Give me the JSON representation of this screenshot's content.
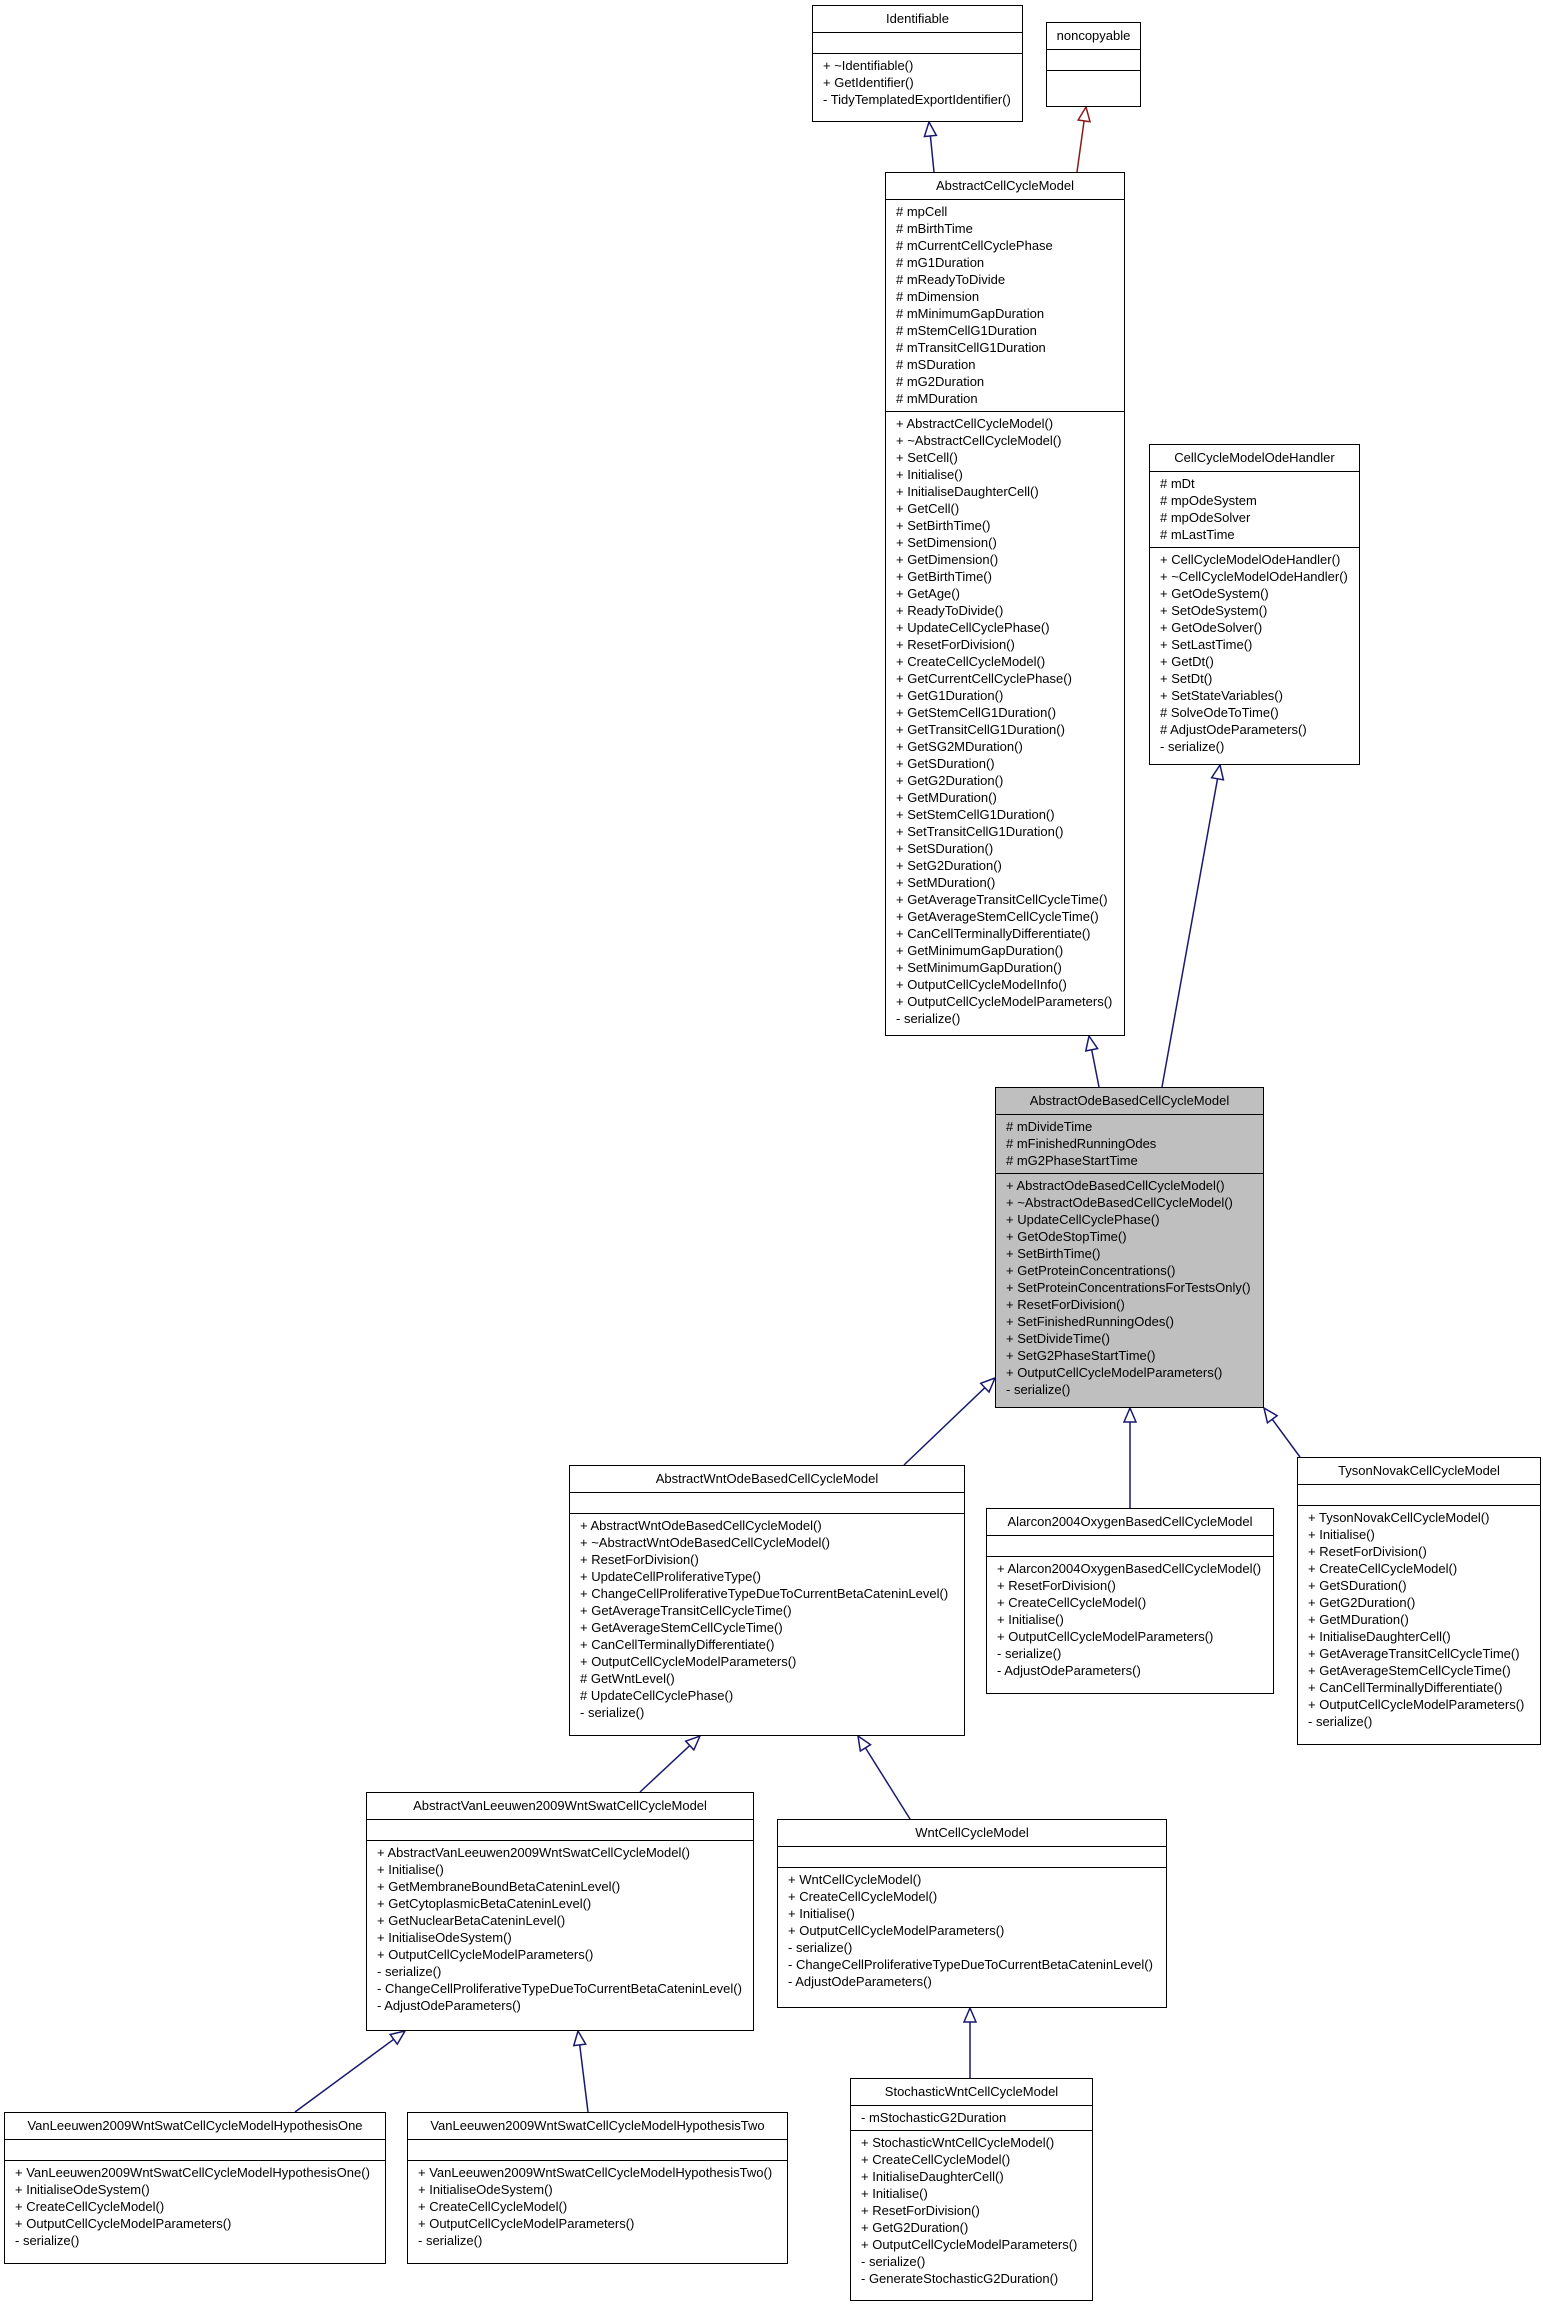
{
  "diagram": {
    "colors": {
      "inherit_public": "#191970",
      "inherit_private": "#8b1a1a",
      "focus_fill": "#bfbfbf"
    },
    "classes": [
      {
        "id": "identifiable",
        "name": "Identifiable",
        "attributes": [],
        "methods": [
          "+ ~Identifiable()",
          "+ GetIdentifier()",
          "- TidyTemplatedExportIdentifier()"
        ]
      },
      {
        "id": "noncopyable",
        "name": "noncopyable",
        "attributes": [],
        "methods": []
      },
      {
        "id": "abstract-cell-cycle-model",
        "name": "AbstractCellCycleModel",
        "attributes": [
          "# mpCell",
          "# mBirthTime",
          "# mCurrentCellCyclePhase",
          "# mG1Duration",
          "# mReadyToDivide",
          "# mDimension",
          "# mMinimumGapDuration",
          "# mStemCellG1Duration",
          "# mTransitCellG1Duration",
          "# mSDuration",
          "# mG2Duration",
          "# mMDuration"
        ],
        "methods": [
          "+ AbstractCellCycleModel()",
          "+ ~AbstractCellCycleModel()",
          "+ SetCell()",
          "+ Initialise()",
          "+ InitialiseDaughterCell()",
          "+ GetCell()",
          "+ SetBirthTime()",
          "+ SetDimension()",
          "+ GetDimension()",
          "+ GetBirthTime()",
          "+ GetAge()",
          "+ ReadyToDivide()",
          "+ UpdateCellCyclePhase()",
          "+ ResetForDivision()",
          "+ CreateCellCycleModel()",
          "+ GetCurrentCellCyclePhase()",
          "+ GetG1Duration()",
          "+ GetStemCellG1Duration()",
          "+ GetTransitCellG1Duration()",
          "+ GetSG2MDuration()",
          "+ GetSDuration()",
          "+ GetG2Duration()",
          "+ GetMDuration()",
          "+ SetStemCellG1Duration()",
          "+ SetTransitCellG1Duration()",
          "+ SetSDuration()",
          "+ SetG2Duration()",
          "+ SetMDuration()",
          "+ GetAverageTransitCellCycleTime()",
          "+ GetAverageStemCellCycleTime()",
          "+ CanCellTerminallyDifferentiate()",
          "+ GetMinimumGapDuration()",
          "+ SetMinimumGapDuration()",
          "+ OutputCellCycleModelInfo()",
          "+ OutputCellCycleModelParameters()",
          "- serialize()"
        ]
      },
      {
        "id": "cell-cycle-model-ode-handler",
        "name": "CellCycleModelOdeHandler",
        "attributes": [
          "# mDt",
          "# mpOdeSystem",
          "# mpOdeSolver",
          "# mLastTime"
        ],
        "methods": [
          "+ CellCycleModelOdeHandler()",
          "+ ~CellCycleModelOdeHandler()",
          "+ GetOdeSystem()",
          "+ SetOdeSystem()",
          "+ GetOdeSolver()",
          "+ SetLastTime()",
          "+ GetDt()",
          "+ SetDt()",
          "+ SetStateVariables()",
          "# SolveOdeToTime()",
          "# AdjustOdeParameters()",
          "- serialize()"
        ]
      },
      {
        "id": "abstract-ode-based-cell-cycle-model",
        "name": "AbstractOdeBasedCellCycleModel",
        "focus": true,
        "attributes": [
          "# mDivideTime",
          "# mFinishedRunningOdes",
          "# mG2PhaseStartTime"
        ],
        "methods": [
          "+ AbstractOdeBasedCellCycleModel()",
          "+ ~AbstractOdeBasedCellCycleModel()",
          "+ UpdateCellCyclePhase()",
          "+ GetOdeStopTime()",
          "+ SetBirthTime()",
          "+ GetProteinConcentrations()",
          "+ SetProteinConcentrationsForTestsOnly()",
          "+ ResetForDivision()",
          "+ SetFinishedRunningOdes()",
          "+ SetDivideTime()",
          "+ SetG2PhaseStartTime()",
          "+ OutputCellCycleModelParameters()",
          "- serialize()"
        ]
      },
      {
        "id": "abstract-wnt-ode-based-cell-cycle-model",
        "name": "AbstractWntOdeBasedCellCycleModel",
        "attributes": [],
        "methods": [
          "+ AbstractWntOdeBasedCellCycleModel()",
          "+ ~AbstractWntOdeBasedCellCycleModel()",
          "+ ResetForDivision()",
          "+ UpdateCellProliferativeType()",
          "+ ChangeCellProliferativeTypeDueToCurrentBetaCateninLevel()",
          "+ GetAverageTransitCellCycleTime()",
          "+ GetAverageStemCellCycleTime()",
          "+ CanCellTerminallyDifferentiate()",
          "+ OutputCellCycleModelParameters()",
          "# GetWntLevel()",
          "# UpdateCellCyclePhase()",
          "- serialize()"
        ]
      },
      {
        "id": "alarcon-2004-oxygen-based-cell-cycle-model",
        "name": "Alarcon2004OxygenBasedCellCycleModel",
        "attributes": [],
        "methods": [
          "+ Alarcon2004OxygenBasedCellCycleModel()",
          "+ ResetForDivision()",
          "+ CreateCellCycleModel()",
          "+ Initialise()",
          "+ OutputCellCycleModelParameters()",
          "- serialize()",
          "- AdjustOdeParameters()"
        ]
      },
      {
        "id": "tyson-novak-cell-cycle-model",
        "name": "TysonNovakCellCycleModel",
        "attributes": [],
        "methods": [
          "+ TysonNovakCellCycleModel()",
          "+ Initialise()",
          "+ ResetForDivision()",
          "+ CreateCellCycleModel()",
          "+ GetSDuration()",
          "+ GetG2Duration()",
          "+ GetMDuration()",
          "+ InitialiseDaughterCell()",
          "+ GetAverageTransitCellCycleTime()",
          "+ GetAverageStemCellCycleTime()",
          "+ CanCellTerminallyDifferentiate()",
          "+ OutputCellCycleModelParameters()",
          "- serialize()"
        ]
      },
      {
        "id": "abstract-van-leeuwen-2009-wnt-swat-cell-cycle-model",
        "name": "AbstractVanLeeuwen2009WntSwatCellCycleModel",
        "attributes": [],
        "methods": [
          "+ AbstractVanLeeuwen2009WntSwatCellCycleModel()",
          "+ Initialise()",
          "+ GetMembraneBoundBetaCateninLevel()",
          "+ GetCytoplasmicBetaCateninLevel()",
          "+ GetNuclearBetaCateninLevel()",
          "+ InitialiseOdeSystem()",
          "+ OutputCellCycleModelParameters()",
          "- serialize()",
          "- ChangeCellProliferativeTypeDueToCurrentBetaCateninLevel()",
          "- AdjustOdeParameters()"
        ]
      },
      {
        "id": "wnt-cell-cycle-model",
        "name": "WntCellCycleModel",
        "attributes": [],
        "methods": [
          "+ WntCellCycleModel()",
          "+ CreateCellCycleModel()",
          "+ Initialise()",
          "+ OutputCellCycleModelParameters()",
          "- serialize()",
          "- ChangeCellProliferativeTypeDueToCurrentBetaCateninLevel()",
          "- AdjustOdeParameters()"
        ]
      },
      {
        "id": "stochastic-wnt-cell-cycle-model",
        "name": "StochasticWntCellCycleModel",
        "attributes": [
          "- mStochasticG2Duration"
        ],
        "methods": [
          "+ StochasticWntCellCycleModel()",
          "+ CreateCellCycleModel()",
          "+ InitialiseDaughterCell()",
          "+ Initialise()",
          "+ ResetForDivision()",
          "+ GetG2Duration()",
          "+ OutputCellCycleModelParameters()",
          "- serialize()",
          "- GenerateStochasticG2Duration()"
        ]
      },
      {
        "id": "van-leeuwen-2009-hypothesis-one",
        "name": "VanLeeuwen2009WntSwatCellCycleModelHypothesisOne",
        "attributes": [],
        "methods": [
          "+ VanLeeuwen2009WntSwatCellCycleModelHypothesisOne()",
          "+ InitialiseOdeSystem()",
          "+ CreateCellCycleModel()",
          "+ OutputCellCycleModelParameters()",
          "- serialize()"
        ]
      },
      {
        "id": "van-leeuwen-2009-hypothesis-two",
        "name": "VanLeeuwen2009WntSwatCellCycleModelHypothesisTwo",
        "attributes": [],
        "methods": [
          "+ VanLeeuwen2009WntSwatCellCycleModelHypothesisTwo()",
          "+ InitialiseOdeSystem()",
          "+ CreateCellCycleModel()",
          "+ OutputCellCycleModelParameters()",
          "- serialize()"
        ]
      }
    ],
    "edges": [
      {
        "from": "abstract-cell-cycle-model",
        "to": "identifiable",
        "kind": "public"
      },
      {
        "from": "abstract-cell-cycle-model",
        "to": "noncopyable",
        "kind": "private"
      },
      {
        "from": "abstract-ode-based-cell-cycle-model",
        "to": "abstract-cell-cycle-model",
        "kind": "public"
      },
      {
        "from": "abstract-ode-based-cell-cycle-model",
        "to": "cell-cycle-model-ode-handler",
        "kind": "public"
      },
      {
        "from": "abstract-wnt-ode-based-cell-cycle-model",
        "to": "abstract-ode-based-cell-cycle-model",
        "kind": "public"
      },
      {
        "from": "alarcon-2004-oxygen-based-cell-cycle-model",
        "to": "abstract-ode-based-cell-cycle-model",
        "kind": "public"
      },
      {
        "from": "tyson-novak-cell-cycle-model",
        "to": "abstract-ode-based-cell-cycle-model",
        "kind": "public"
      },
      {
        "from": "abstract-van-leeuwen-2009-wnt-swat-cell-cycle-model",
        "to": "abstract-wnt-ode-based-cell-cycle-model",
        "kind": "public"
      },
      {
        "from": "wnt-cell-cycle-model",
        "to": "abstract-wnt-ode-based-cell-cycle-model",
        "kind": "public"
      },
      {
        "from": "stochastic-wnt-cell-cycle-model",
        "to": "wnt-cell-cycle-model",
        "kind": "public"
      },
      {
        "from": "van-leeuwen-2009-hypothesis-one",
        "to": "abstract-van-leeuwen-2009-wnt-swat-cell-cycle-model",
        "kind": "public"
      },
      {
        "from": "van-leeuwen-2009-hypothesis-two",
        "to": "abstract-van-leeuwen-2009-wnt-swat-cell-cycle-model",
        "kind": "public"
      }
    ]
  }
}
